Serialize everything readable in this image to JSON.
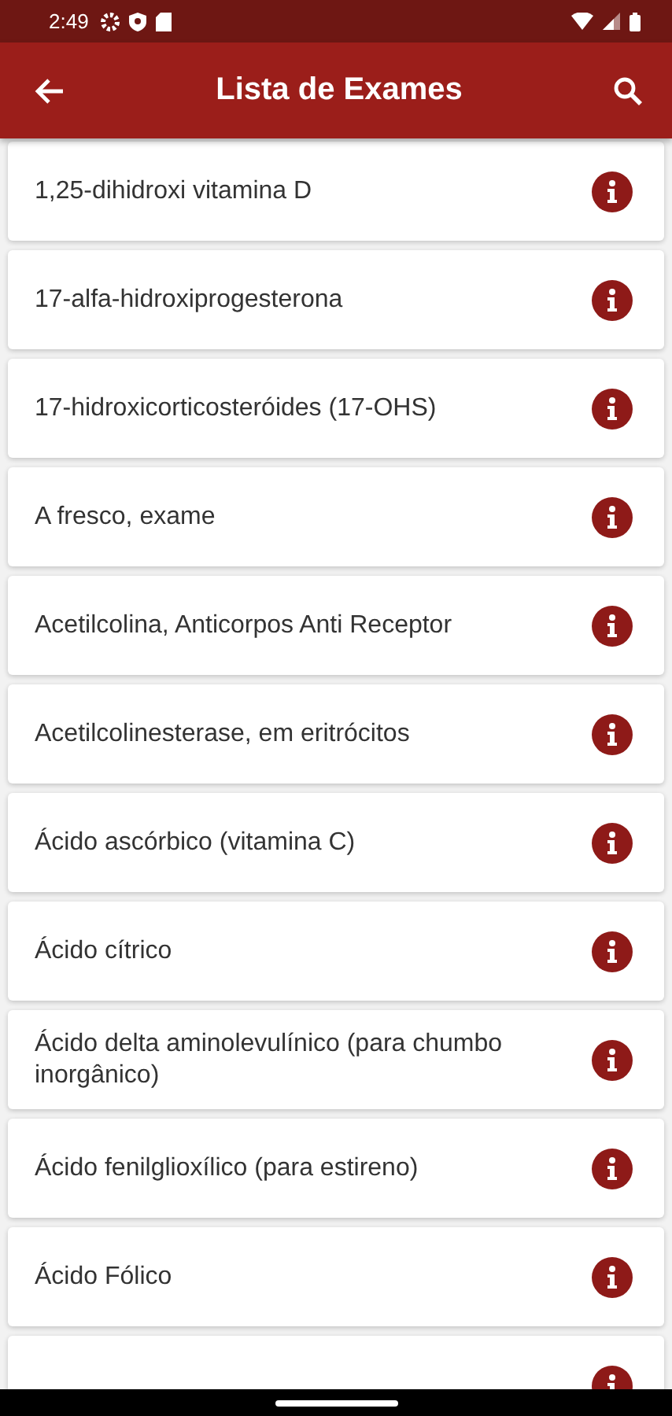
{
  "status_bar": {
    "time": "2:49"
  },
  "app_bar": {
    "title": "Lista de Exames"
  },
  "exams": [
    {
      "name": "1,25-dihidroxi vitamina D"
    },
    {
      "name": "17-alfa-hidroxiprogesterona"
    },
    {
      "name": "17-hidroxicorticosteróides (17-OHS)"
    },
    {
      "name": "A fresco, exame"
    },
    {
      "name": "Acetilcolina, Anticorpos Anti Receptor"
    },
    {
      "name": "Acetilcolinesterase, em eritrócitos"
    },
    {
      "name": "Ácido ascórbico (vitamina C)"
    },
    {
      "name": "Ácido cítrico"
    },
    {
      "name": "Ácido delta aminolevulínico (para chumbo inorgânico)"
    },
    {
      "name": "Ácido fenilglioxílico (para estireno)"
    },
    {
      "name": "Ácido Fólico"
    }
  ]
}
